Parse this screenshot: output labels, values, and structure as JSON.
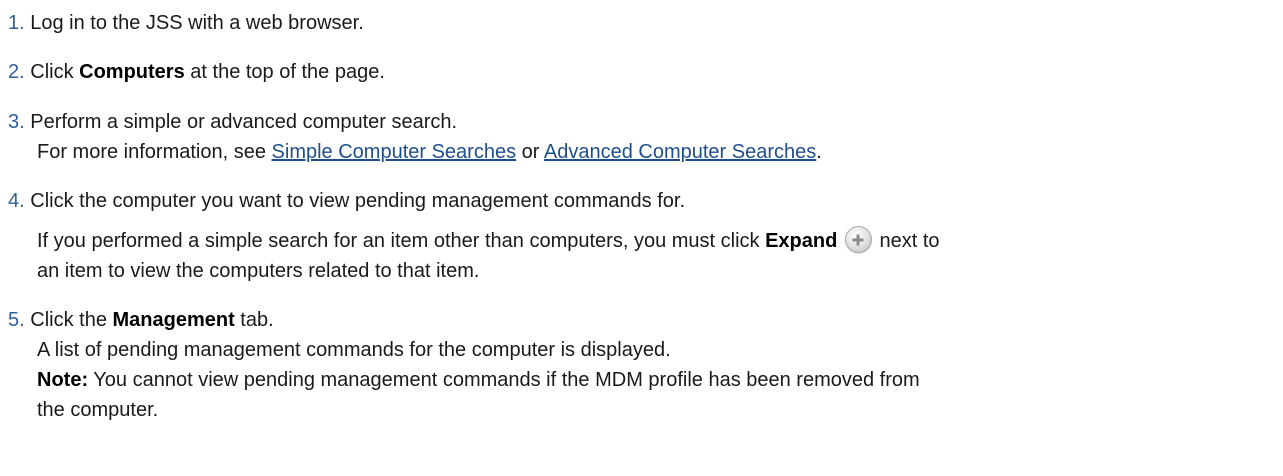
{
  "steps": [
    {
      "number": "1.",
      "text": "Log in to the JSS with a web browser."
    },
    {
      "number": "2.",
      "pre": "Click ",
      "bold": "Computers",
      "post": " at the top of the page."
    },
    {
      "number": "3.",
      "text": "Perform a simple or advanced computer search.",
      "line2_pre": "For more information, see ",
      "link1": "Simple Computer Searches",
      "line2_mid": " or ",
      "link2": "Advanced Computer Searches",
      "line2_post": "."
    },
    {
      "number": "4.",
      "text": "Click the computer you want to view pending management commands for.",
      "para_pre": "If you performed a simple search for an item other than computers, you must click ",
      "para_bold": "Expand",
      "para_post_a": " next to",
      "para_line2": "an item to view the computers related to that item."
    },
    {
      "number": "5.",
      "pre": "Click the ",
      "bold": "Management",
      "post": " tab.",
      "line2": "A list of pending management commands for the computer is displayed.",
      "note_label": "Note:",
      "note_text": " You cannot view pending management commands if the MDM profile has been removed from",
      "note_line2": "the computer."
    }
  ]
}
